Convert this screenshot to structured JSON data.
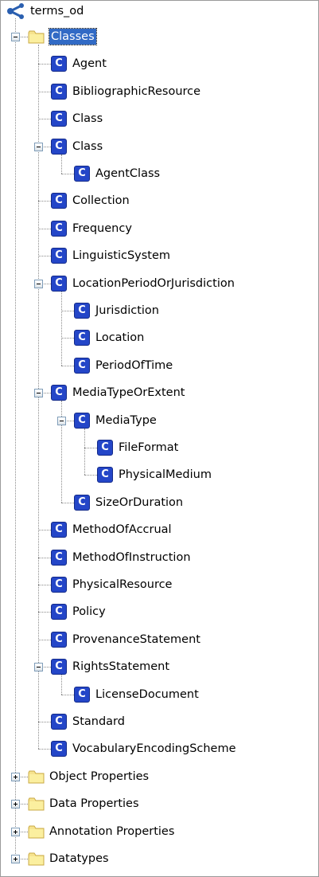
{
  "root": {
    "label": "terms_od",
    "icon": "ontology-icon"
  },
  "colors": {
    "selection": "#316ac5",
    "class_icon": "#2446c8",
    "folder": "#f2e08a"
  },
  "tree": [
    {
      "label": "Classes",
      "type": "folder",
      "expanded": true,
      "selected": true,
      "children": [
        {
          "label": "Agent",
          "type": "class"
        },
        {
          "label": "BibliographicResource",
          "type": "class"
        },
        {
          "label": "Class",
          "type": "class"
        },
        {
          "label": "Class",
          "type": "class",
          "expanded": true,
          "children": [
            {
              "label": "AgentClass",
              "type": "class"
            }
          ]
        },
        {
          "label": "Collection",
          "type": "class"
        },
        {
          "label": "Frequency",
          "type": "class"
        },
        {
          "label": "LinguisticSystem",
          "type": "class"
        },
        {
          "label": "LocationPeriodOrJurisdiction",
          "type": "class",
          "expanded": true,
          "children": [
            {
              "label": "Jurisdiction",
              "type": "class"
            },
            {
              "label": "Location",
              "type": "class"
            },
            {
              "label": "PeriodOfTime",
              "type": "class"
            }
          ]
        },
        {
          "label": "MediaTypeOrExtent",
          "type": "class",
          "expanded": true,
          "children": [
            {
              "label": "MediaType",
              "type": "class",
              "expanded": true,
              "children": [
                {
                  "label": "FileFormat",
                  "type": "class"
                },
                {
                  "label": "PhysicalMedium",
                  "type": "class"
                }
              ]
            },
            {
              "label": "SizeOrDuration",
              "type": "class"
            }
          ]
        },
        {
          "label": "MethodOfAccrual",
          "type": "class"
        },
        {
          "label": "MethodOfInstruction",
          "type": "class"
        },
        {
          "label": "PhysicalResource",
          "type": "class"
        },
        {
          "label": "Policy",
          "type": "class"
        },
        {
          "label": "ProvenanceStatement",
          "type": "class"
        },
        {
          "label": "RightsStatement",
          "type": "class",
          "expanded": true,
          "children": [
            {
              "label": "LicenseDocument",
              "type": "class"
            }
          ]
        },
        {
          "label": "Standard",
          "type": "class"
        },
        {
          "label": "VocabularyEncodingScheme",
          "type": "class"
        }
      ]
    },
    {
      "label": "Object Properties",
      "type": "folder",
      "expanded": false
    },
    {
      "label": "Data Properties",
      "type": "folder",
      "expanded": false
    },
    {
      "label": "Annotation Properties",
      "type": "folder",
      "expanded": false
    },
    {
      "label": "Datatypes",
      "type": "folder",
      "expanded": false
    }
  ]
}
